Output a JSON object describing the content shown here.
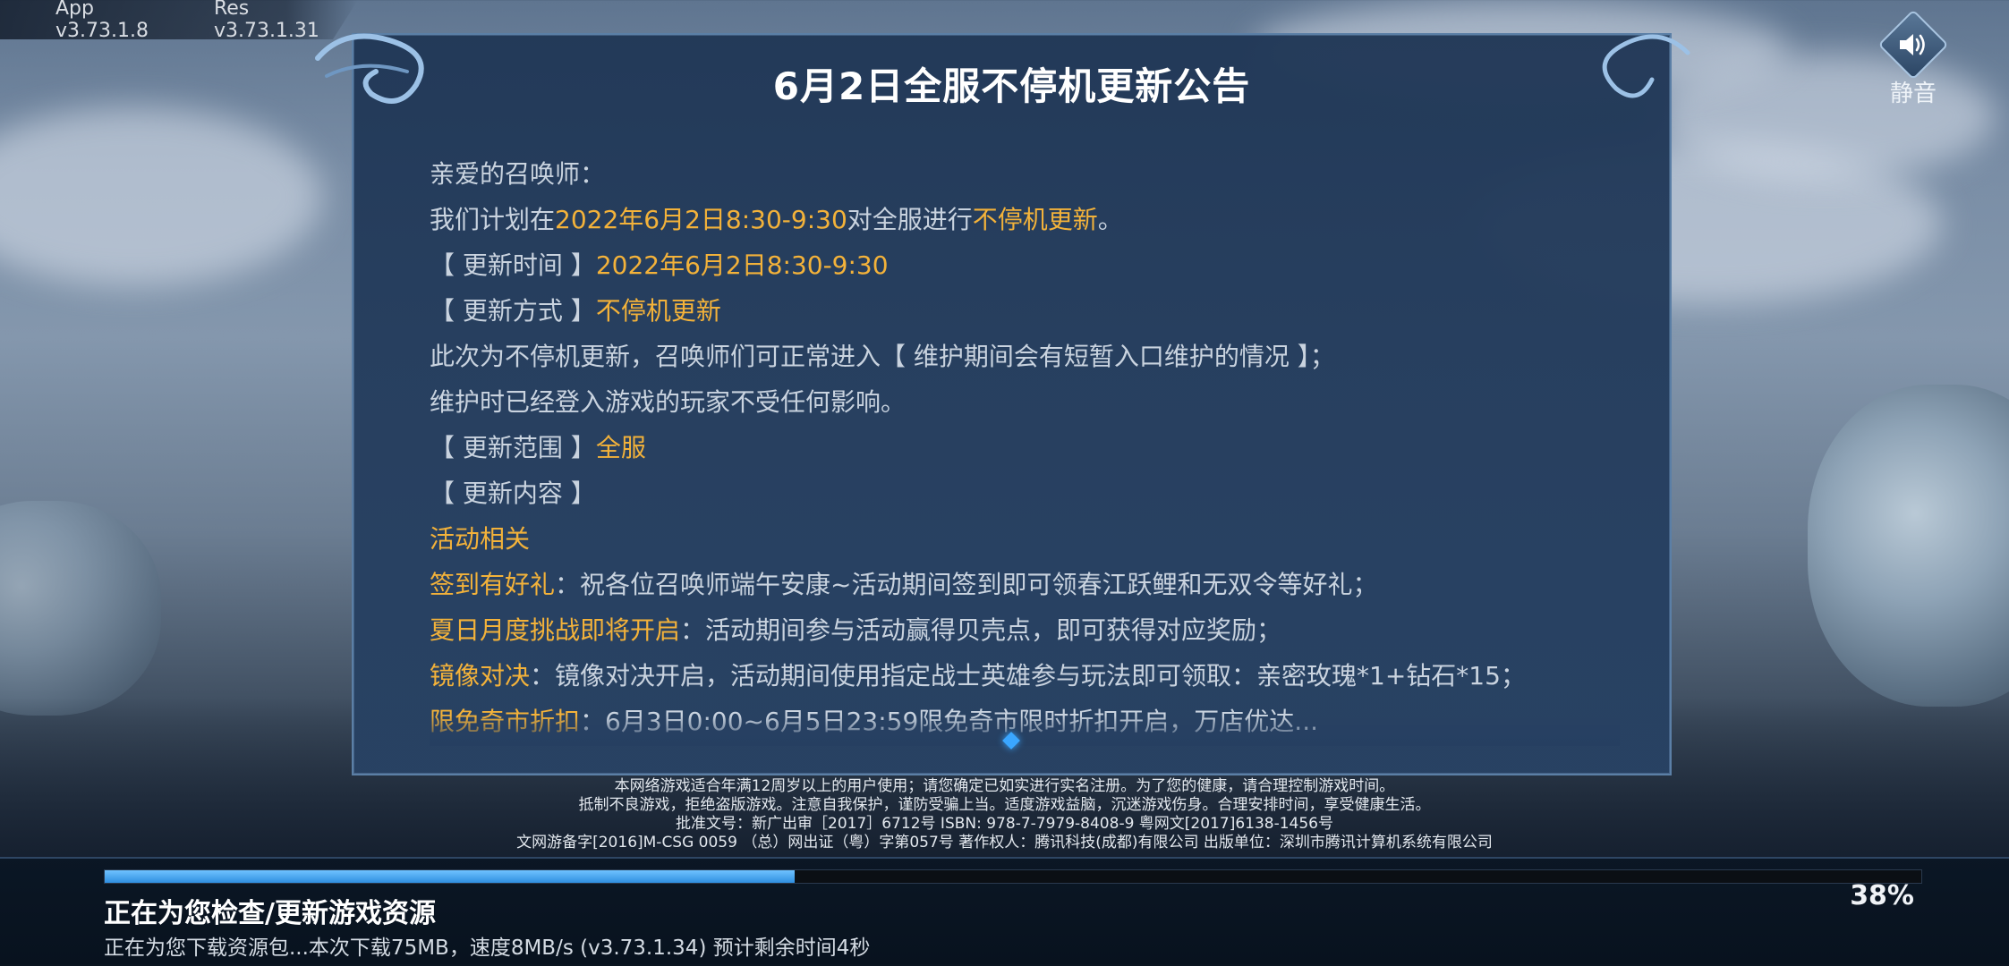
{
  "version": {
    "app": "App v3.73.1.8",
    "res": "Res v3.73.1.31"
  },
  "mute_button": {
    "icon": "speaker-icon",
    "label": "静音"
  },
  "notice": {
    "title": "6月2日全服不停机更新公告",
    "greeting": "亲爱的召唤师：",
    "plan": {
      "pre": "我们计划在",
      "time": "2022年6月2日8:30-9:30",
      "mid": "对全服进行",
      "type": "不停机更新",
      "post": "。"
    },
    "update_time": {
      "label": "【 更新时间 】",
      "value": "2022年6月2日8:30-9:30"
    },
    "update_mode": {
      "label": "【 更新方式 】",
      "value": "不停机更新"
    },
    "desc_1": "此次为不停机更新，召唤师们可正常进入【 维护期间会有短暂入口维护的情况 】；",
    "desc_2": "维护时已经登入游戏的玩家不受任何影响。",
    "update_scope": {
      "label": "【 更新范围 】",
      "value": "全服"
    },
    "update_content_label": "【 更新内容 】",
    "section_activity": "活动相关",
    "items": [
      {
        "name": "签到有好礼",
        "text": "：祝各位召唤师端午安康~活动期间签到即可领春江跃鲤和无双令等好礼；"
      },
      {
        "name": "夏日月度挑战即将开启",
        "text": "：活动期间参与活动赢得贝壳点，即可获得对应奖励；"
      },
      {
        "name": "镜像对决",
        "text": "：镜像对决开启，活动期间使用指定战士英雄参与玩法即可领取：亲密玫瑰*1+钻石*15；"
      },
      {
        "name": "限免奇市折扣",
        "text": "：6月3日0:00~6月5日23:59限免奇市限时折扣开启，万店优达..."
      }
    ]
  },
  "legal": {
    "line1": "本网络游戏适合年满12周岁以上的用户使用；请您确定已如实进行实名注册。为了您的健康，请合理控制游戏时间。",
    "line2": "抵制不良游戏，拒绝盗版游戏。注意自我保护，谨防受骗上当。适度游戏益脑，沉迷游戏伤身。合理安排时间，享受健康生活。",
    "line3": "批准文号：新广出审［2017］6712号 ISBN: 978-7-7979-8408-9 粤网文[2017]6138-1456号",
    "line4": "文网游备字[2016]M-CSG 0059 （总）网出证（粤）字第057号 著作权人：腾讯科技(成都)有限公司 出版单位：深圳市腾讯计算机系统有限公司"
  },
  "download": {
    "progress": 0.38,
    "percent_label": "38%",
    "status": "正在为您检查/更新游戏资源",
    "detail": "正在为您下载资源包...本次下载75MB，速度8MB/s (v3.73.1.34) 预计剩余时间4秒"
  }
}
